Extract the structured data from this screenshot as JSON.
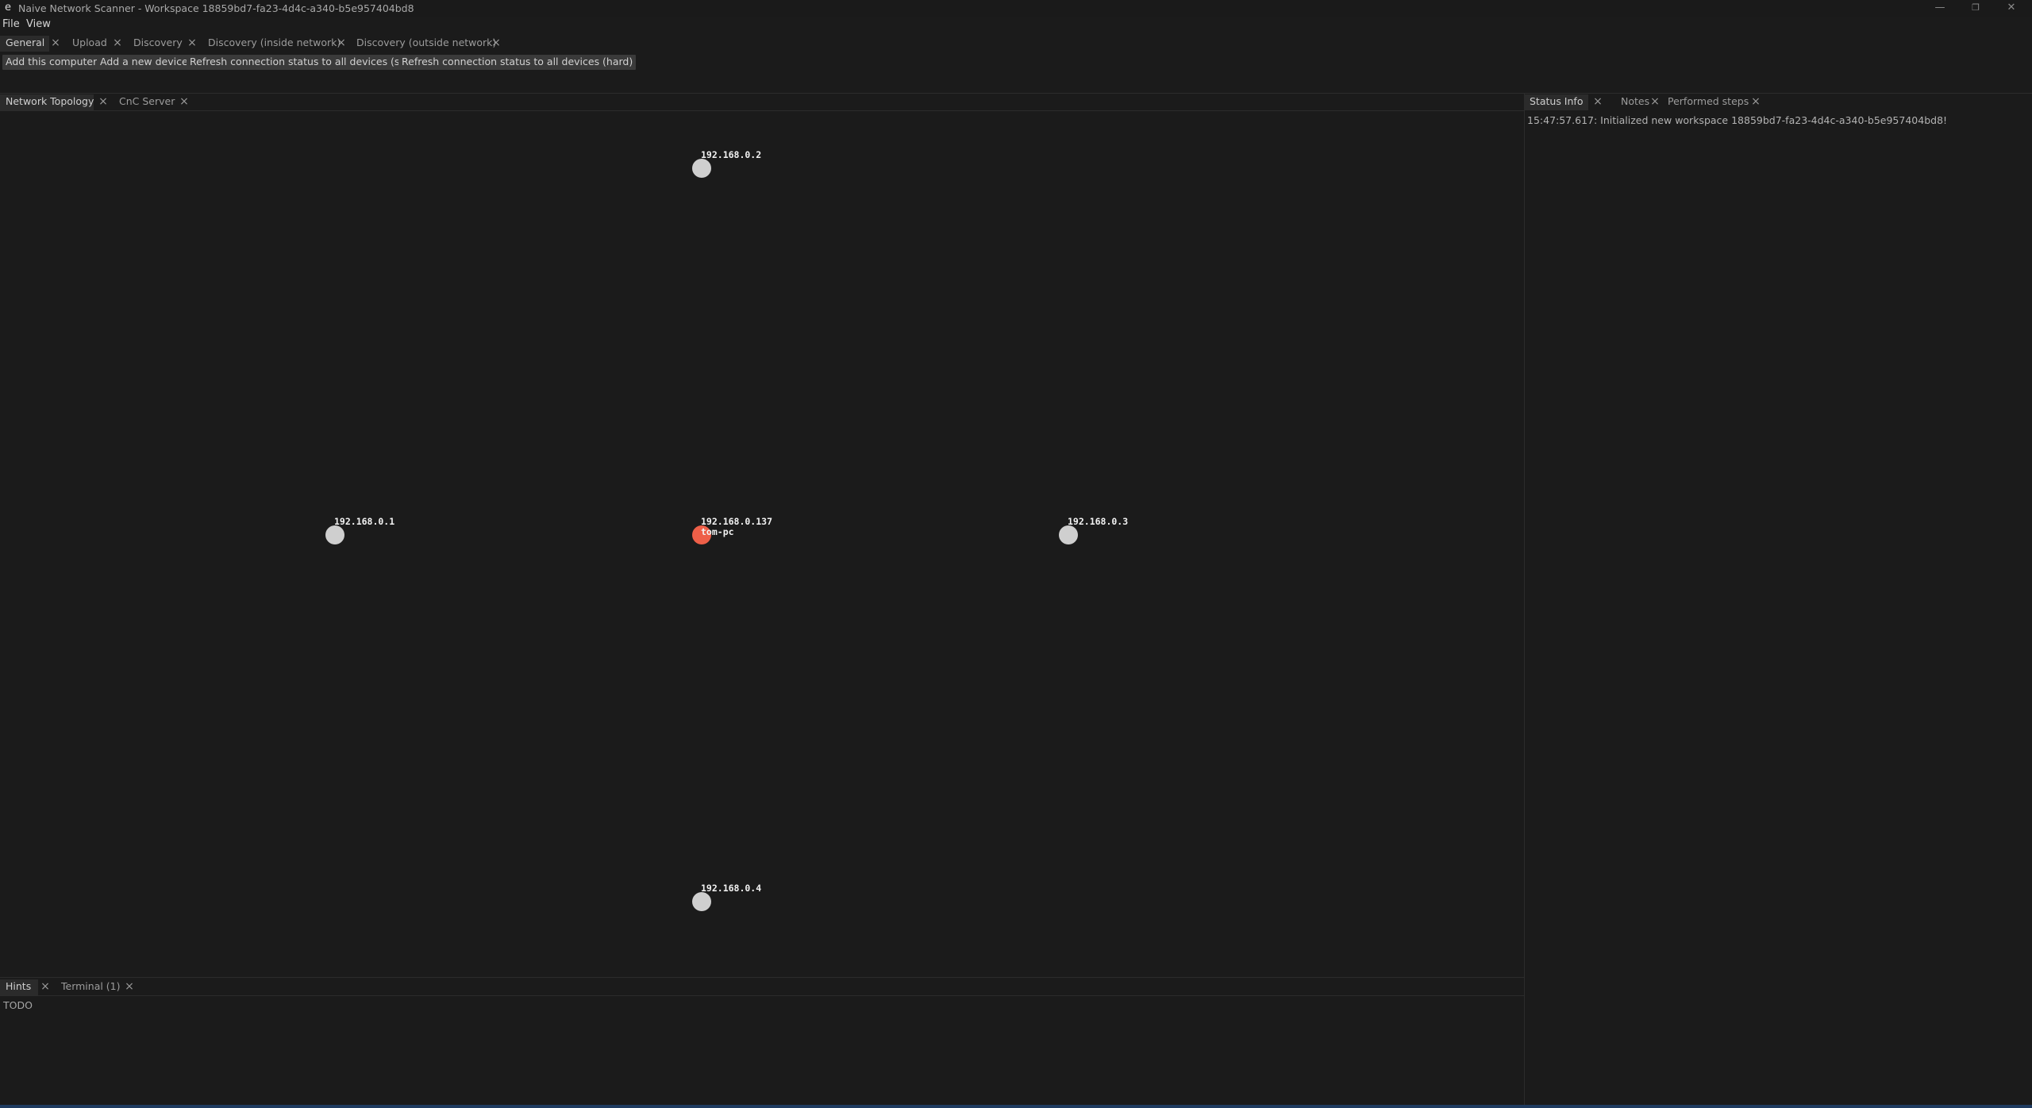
{
  "window": {
    "app_icon": "e",
    "title": "Naive Network Scanner - Workspace 18859bd7-fa23-4d4c-a340-b5e957404bd8",
    "minimize": "—",
    "restore": "❐",
    "close": "✕"
  },
  "menu": {
    "items": [
      "File",
      "View"
    ]
  },
  "top_tabs": [
    {
      "label": "General",
      "closable": true
    },
    {
      "label": "Upload",
      "closable": true
    },
    {
      "label": "Discovery",
      "closable": true
    },
    {
      "label": "Discovery (inside network)",
      "closable": true
    },
    {
      "label": "Discovery (outside network)",
      "closable": true
    }
  ],
  "toolbar": {
    "buttons": [
      "Add this computer",
      "Add a new device",
      "Refresh connection status to all devices (soft)",
      "Refresh connection status to all devices (hard)"
    ]
  },
  "main_tabs": [
    {
      "label": "Network Topology",
      "active": true
    },
    {
      "label": "CnC Server",
      "active": false
    }
  ],
  "topology": {
    "nodes": [
      {
        "ip": "192.168.0.2",
        "hostname": "",
        "is_self": false
      },
      {
        "ip": "192.168.0.1",
        "hostname": "",
        "is_self": false
      },
      {
        "ip": "192.168.0.137",
        "hostname": "tom-pc",
        "is_self": true
      },
      {
        "ip": "192.168.0.3",
        "hostname": "",
        "is_self": false
      },
      {
        "ip": "192.168.0.4",
        "hostname": "",
        "is_self": false
      }
    ],
    "colors": {
      "node": "#cfcfcf",
      "self_node": "#ee5f48"
    }
  },
  "side_tabs": [
    {
      "label": "Status Info",
      "active": true
    },
    {
      "label": "Notes",
      "active": false
    },
    {
      "label": "Performed steps",
      "active": false
    }
  ],
  "status_info": {
    "log": "15:47:57.617: Initialized new workspace 18859bd7-fa23-4d4c-a340-b5e957404bd8!"
  },
  "bottom_tabs": [
    {
      "label": "Hints",
      "active": true
    },
    {
      "label": "Terminal (1)",
      "active": false
    }
  ],
  "hints": {
    "text": "TODO"
  }
}
